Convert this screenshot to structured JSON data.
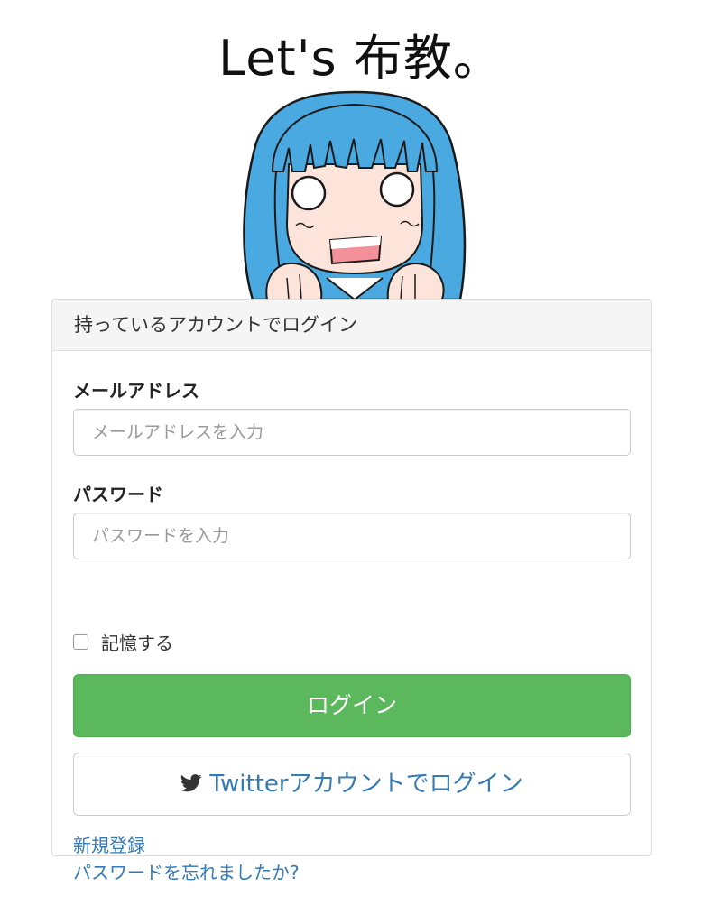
{
  "hero": {
    "title": "Let's 布教。"
  },
  "login_panel": {
    "heading": "持っているアカウントでログイン",
    "email": {
      "label": "メールアドレス",
      "placeholder": "メールアドレスを入力",
      "value": ""
    },
    "password": {
      "label": "パスワード",
      "placeholder": "パスワードを入力",
      "value": ""
    },
    "remember": {
      "label": "記憶する",
      "checked": false
    },
    "login_button": "ログイン",
    "twitter_button": "Twitterアカウントでログイン",
    "links": {
      "register": "新規登録",
      "forgot_password": "パスワードを忘れましたか?"
    }
  },
  "icons": {
    "twitter": "twitter-bird-icon"
  },
  "colors": {
    "login_button_bg": "#5cb85c",
    "link": "#337ab7",
    "panel_heading_bg": "#f5f5f5",
    "mascot_hair": "#4aa9e0"
  }
}
